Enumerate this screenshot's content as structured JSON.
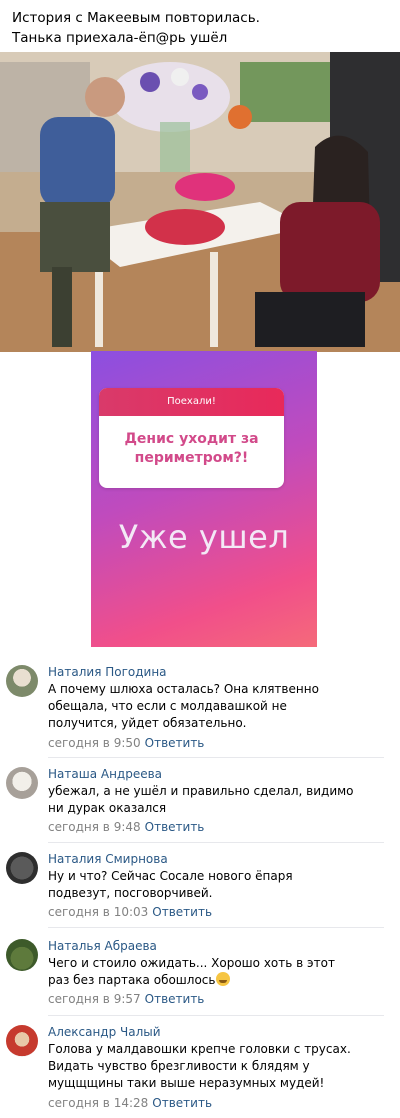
{
  "post": {
    "line1": "История с Макеевым повторилась.",
    "line2": "Танька приехала-ёп@рь ушёл"
  },
  "story": {
    "question_header": "Поехали!",
    "question_line1": "Денис уходит за",
    "question_line2": "периметром?!",
    "answer": "Уже ушел"
  },
  "comments": [
    {
      "author": "Наталия Погодина",
      "lines": [
        "А почему шлюха осталась? Она клятвенно",
        "обещала, что если с молдавашкой не",
        "получится, уйдет обязательно."
      ],
      "time": "сегодня в 9:50",
      "reply": "Ответить"
    },
    {
      "author": "Наташа Андреева",
      "lines": [
        "убежал, а не ушёл и правильно сделал, видимо",
        "ни дурак оказался"
      ],
      "time": "сегодня в 9:48",
      "reply": "Ответить"
    },
    {
      "author": "Наталия Смирнова",
      "lines": [
        "Ну и что? Сейчас Сосале нового ёпаря",
        "подвезут, посговорчивей."
      ],
      "time": "сегодня в 10:03",
      "reply": "Ответить"
    },
    {
      "author": "Наталья Абраева",
      "lines": [
        "Чего и стоило ожидать... Хорошо хоть в этот",
        "раз без партака обошлось"
      ],
      "time": "сегодня в 9:57",
      "reply": "Ответить"
    },
    {
      "author": "Александр Чалый",
      "lines": [
        "Голова у малдавошки крепче головки с трусах.",
        "Видать чувство брезгливости к блядям у",
        "мущщщины таки выше неразумных мудей!"
      ],
      "time": "сегодня в 14:28",
      "reply": "Ответить"
    }
  ],
  "icons": {
    "comment_4_emoji": "grinning-sweat-emoji"
  },
  "colors": {
    "link": "#2a5885",
    "meta": "#828282",
    "story_gradient_start": "#8c4fe0",
    "story_gradient_end": "#f56a7a",
    "question_header": "#e8295a",
    "question_text": "#d24a8a"
  }
}
